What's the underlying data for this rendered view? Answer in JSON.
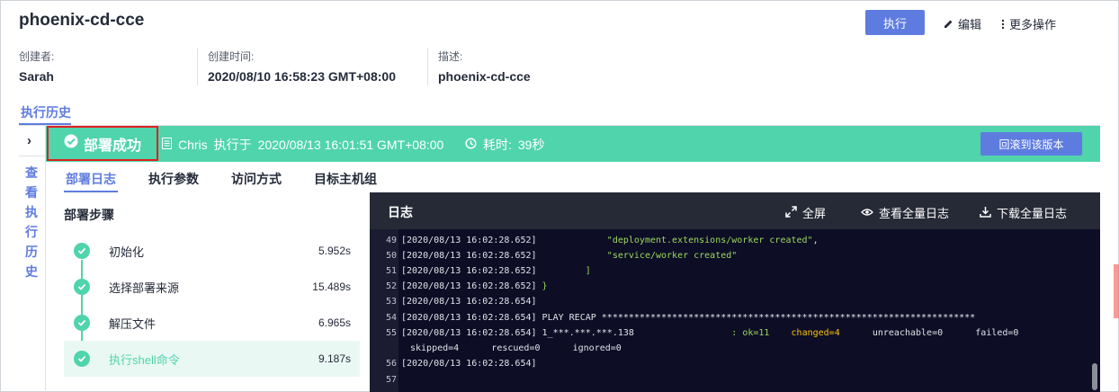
{
  "header": {
    "title": "phoenix-cd-cce",
    "run_label": "执行",
    "edit_label": "编辑",
    "more_label": "更多操作"
  },
  "meta": [
    {
      "label": "创建者:",
      "value": "Sarah"
    },
    {
      "label": "创建时间:",
      "value": "2020/08/10 16:58:23 GMT+08:00"
    },
    {
      "label": "描述:",
      "value": "phoenix-cd-cce"
    }
  ],
  "history_tab": "执行历史",
  "rail": {
    "chevron": "›",
    "text": "查看执行历史"
  },
  "status": {
    "state": "部署成功",
    "executor": "Chris",
    "executed_at_label": "执行于",
    "executed_at": "2020/08/13 16:01:51 GMT+08:00",
    "duration_label": "耗时:",
    "duration": "39秒",
    "rollback_label": "回滚到该版本"
  },
  "subtabs": [
    "部署日志",
    "执行参数",
    "访问方式",
    "目标主机组"
  ],
  "steps_title": "部署步骤",
  "steps": [
    {
      "name": "初始化",
      "duration": "5.952s"
    },
    {
      "name": "选择部署来源",
      "duration": "15.489s"
    },
    {
      "name": "解压文件",
      "duration": "6.965s"
    },
    {
      "name": "执行shell命令",
      "duration": "9.187s"
    }
  ],
  "log": {
    "title": "日志",
    "fullscreen_label": "全屏",
    "view_all_label": "查看全量日志",
    "download_label": "下载全量日志",
    "lines": [
      {
        "no": "49",
        "ts": "[2020/08/13 16:02:28.652]",
        "pad": "             ",
        "green": "\"deployment.extensions/worker created\"",
        "rest": ","
      },
      {
        "no": "50",
        "ts": "[2020/08/13 16:02:28.652]",
        "pad": "             ",
        "green": "\"service/worker created\"",
        "rest": ""
      },
      {
        "no": "51",
        "ts": "[2020/08/13 16:02:28.652]",
        "pad": "         ",
        "green": "]",
        "rest": ""
      },
      {
        "no": "52",
        "ts": "[2020/08/13 16:02:28.652]",
        "pad": " ",
        "green": "}",
        "rest": ""
      },
      {
        "no": "53",
        "ts": "[2020/08/13 16:02:28.654]",
        "pad": "",
        "green": "",
        "rest": ""
      },
      {
        "no": "54",
        "ts": "[2020/08/13 16:02:28.654]",
        "pad": " ",
        "green": "",
        "rest": "PLAY RECAP *********************************************************************"
      },
      {
        "no": "56",
        "ts": "[2020/08/13 16:02:28.654]",
        "pad": "",
        "green": "",
        "rest": ""
      },
      {
        "no": "57",
        "ts": "",
        "pad": "",
        "green": "",
        "rest": ""
      }
    ],
    "recap": {
      "no": "55",
      "ts": "[2020/08/13 16:02:28.654]",
      "host": "1_***.***.***.138",
      "ok": ": ok=11",
      "changed": "changed=4",
      "unreachable": "unreachable=0",
      "failed": "failed=0",
      "cont": "skipped=4      rescued=0      ignored=0"
    }
  },
  "colors": {
    "accent": "#5e7ce0",
    "success": "#50d4ab",
    "highlight": "#e02020",
    "log_bg": "#0d0d26"
  }
}
